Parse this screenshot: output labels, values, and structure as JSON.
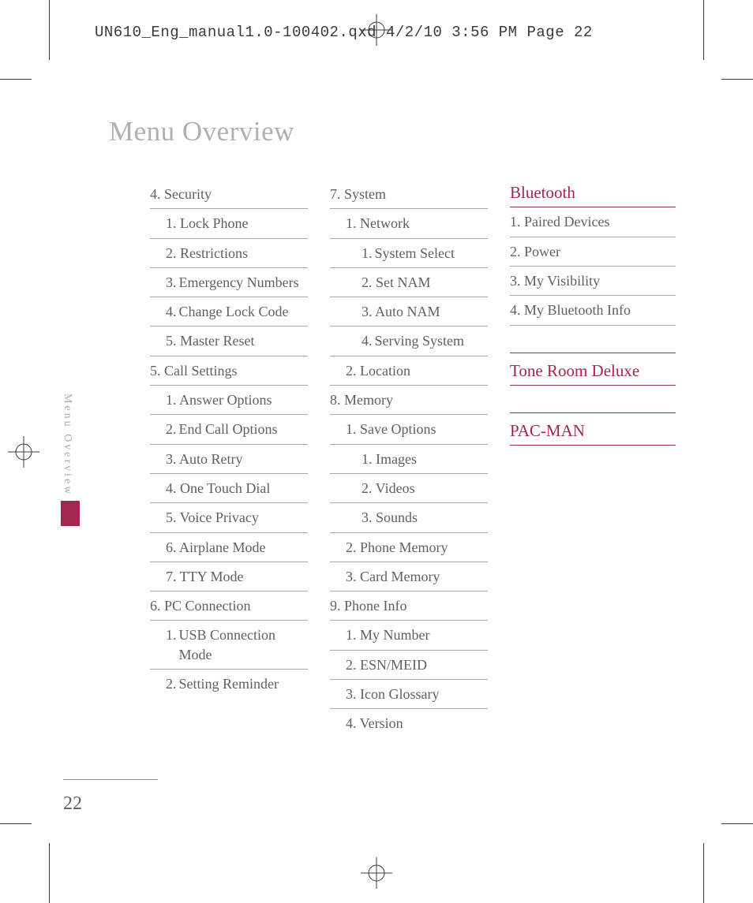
{
  "header_info": "UN610_Eng_manual1.0-100402.qxd  4/2/10  3:56 PM  Page 22",
  "page_title": "Menu Overview",
  "side_tab_label": "Menu Overview",
  "page_number": "22",
  "col1": [
    {
      "text": "4. Security",
      "indent": 0,
      "ruled": true
    },
    {
      "text": "1. Lock Phone",
      "indent": 1,
      "ruled": true
    },
    {
      "text": "2. Restrictions",
      "indent": 1,
      "ruled": true
    },
    {
      "num": "3.",
      "text": "Emergency Numbers",
      "indent": 1,
      "ruled": true,
      "hang": true
    },
    {
      "num": "4.",
      "text": "Change Lock Code",
      "indent": 1,
      "ruled": true,
      "hang": true
    },
    {
      "text": "5. Master Reset",
      "indent": 1,
      "ruled": true
    },
    {
      "text": "5. Call Settings",
      "indent": 0,
      "ruled": true
    },
    {
      "text": "1. Answer Options",
      "indent": 1,
      "ruled": true
    },
    {
      "num": "2.",
      "text": "End Call Options",
      "indent": 1,
      "ruled": true,
      "hang": true
    },
    {
      "text": "3. Auto Retry",
      "indent": 1,
      "ruled": true
    },
    {
      "text": "4. One Touch Dial",
      "indent": 1,
      "ruled": true
    },
    {
      "text": "5. Voice Privacy",
      "indent": 1,
      "ruled": true
    },
    {
      "text": "6. Airplane Mode",
      "indent": 1,
      "ruled": true
    },
    {
      "text": "7. TTY Mode",
      "indent": 1,
      "ruled": true
    },
    {
      "text": "6.  PC Connection",
      "indent": 0,
      "ruled": true
    },
    {
      "num": "1.",
      "text": "USB Connection Mode",
      "indent": 1,
      "ruled": true,
      "hang": true
    },
    {
      "num": "2.",
      "text": "Setting Reminder",
      "indent": 1,
      "ruled": false,
      "hang": true
    }
  ],
  "col2": [
    {
      "text": "7.  System",
      "indent": 0,
      "ruled": true
    },
    {
      "text": "1. Network",
      "indent": 1,
      "ruled": true
    },
    {
      "num": "1.",
      "text": "System Select",
      "indent": 2,
      "ruled": true,
      "hang": true
    },
    {
      "text": "2. Set NAM",
      "indent": 2,
      "ruled": true
    },
    {
      "text": "3. Auto NAM",
      "indent": 2,
      "ruled": true
    },
    {
      "num": "4.",
      "text": "Serving System",
      "indent": 2,
      "ruled": true,
      "hang": true
    },
    {
      "text": "2. Location",
      "indent": 1,
      "ruled": true
    },
    {
      "text": "8.  Memory",
      "indent": 0,
      "ruled": true
    },
    {
      "text": "1. Save Options",
      "indent": 1,
      "ruled": true
    },
    {
      "text": "1. Images",
      "indent": 2,
      "ruled": true
    },
    {
      "text": "2. Videos",
      "indent": 2,
      "ruled": true
    },
    {
      "text": "3. Sounds",
      "indent": 2,
      "ruled": true
    },
    {
      "text": "2. Phone Memory",
      "indent": 1,
      "ruled": true
    },
    {
      "text": "3. Card Memory",
      "indent": 1,
      "ruled": true
    },
    {
      "text": "9. Phone Info",
      "indent": 0,
      "ruled": true
    },
    {
      "text": "1. My Number",
      "indent": 1,
      "ruled": true
    },
    {
      "text": "2. ESN/MEID",
      "indent": 1,
      "ruled": true
    },
    {
      "text": "3. Icon Glossary",
      "indent": 1,
      "ruled": true
    },
    {
      "text": "4. Version",
      "indent": 1,
      "ruled": false
    }
  ],
  "col3": {
    "bluetooth_head": "Bluetooth",
    "bluetooth_items": [
      "1. Paired Devices",
      "2. Power",
      "3. My Visibility",
      "4. My Bluetooth Info"
    ],
    "tone_room_head": "Tone Room Deluxe",
    "pacman_head": "PAC-MAN"
  }
}
